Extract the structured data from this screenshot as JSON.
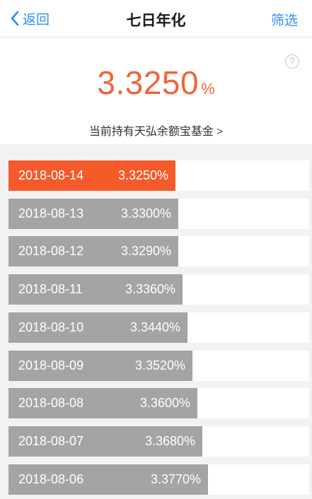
{
  "nav": {
    "back_label": "返回",
    "title": "七日年化",
    "filter_label": "筛选"
  },
  "summary": {
    "rate": "3.3250",
    "unit": "%",
    "holding_text": "当前持有天弘余额宝基金",
    "holding_chevron": ">",
    "help_symbol": "?"
  },
  "colors": {
    "accent": "#f0643a",
    "current_bar": "#f45a2a",
    "past_bar": "#a4a4a6",
    "link": "#2f8ef0"
  },
  "history": [
    {
      "date": "2018-08-14",
      "rate_label": "3.3250%",
      "rate": 3.325,
      "current": true
    },
    {
      "date": "2018-08-13",
      "rate_label": "3.3300%",
      "rate": 3.33,
      "current": false
    },
    {
      "date": "2018-08-12",
      "rate_label": "3.3290%",
      "rate": 3.329,
      "current": false
    },
    {
      "date": "2018-08-11",
      "rate_label": "3.3360%",
      "rate": 3.336,
      "current": false
    },
    {
      "date": "2018-08-10",
      "rate_label": "3.3440%",
      "rate": 3.344,
      "current": false
    },
    {
      "date": "2018-08-09",
      "rate_label": "3.3520%",
      "rate": 3.352,
      "current": false
    },
    {
      "date": "2018-08-08",
      "rate_label": "3.3600%",
      "rate": 3.36,
      "current": false
    },
    {
      "date": "2018-08-07",
      "rate_label": "3.3680%",
      "rate": 3.368,
      "current": false
    },
    {
      "date": "2018-08-06",
      "rate_label": "3.3770%",
      "rate": 3.377,
      "current": false
    }
  ]
}
